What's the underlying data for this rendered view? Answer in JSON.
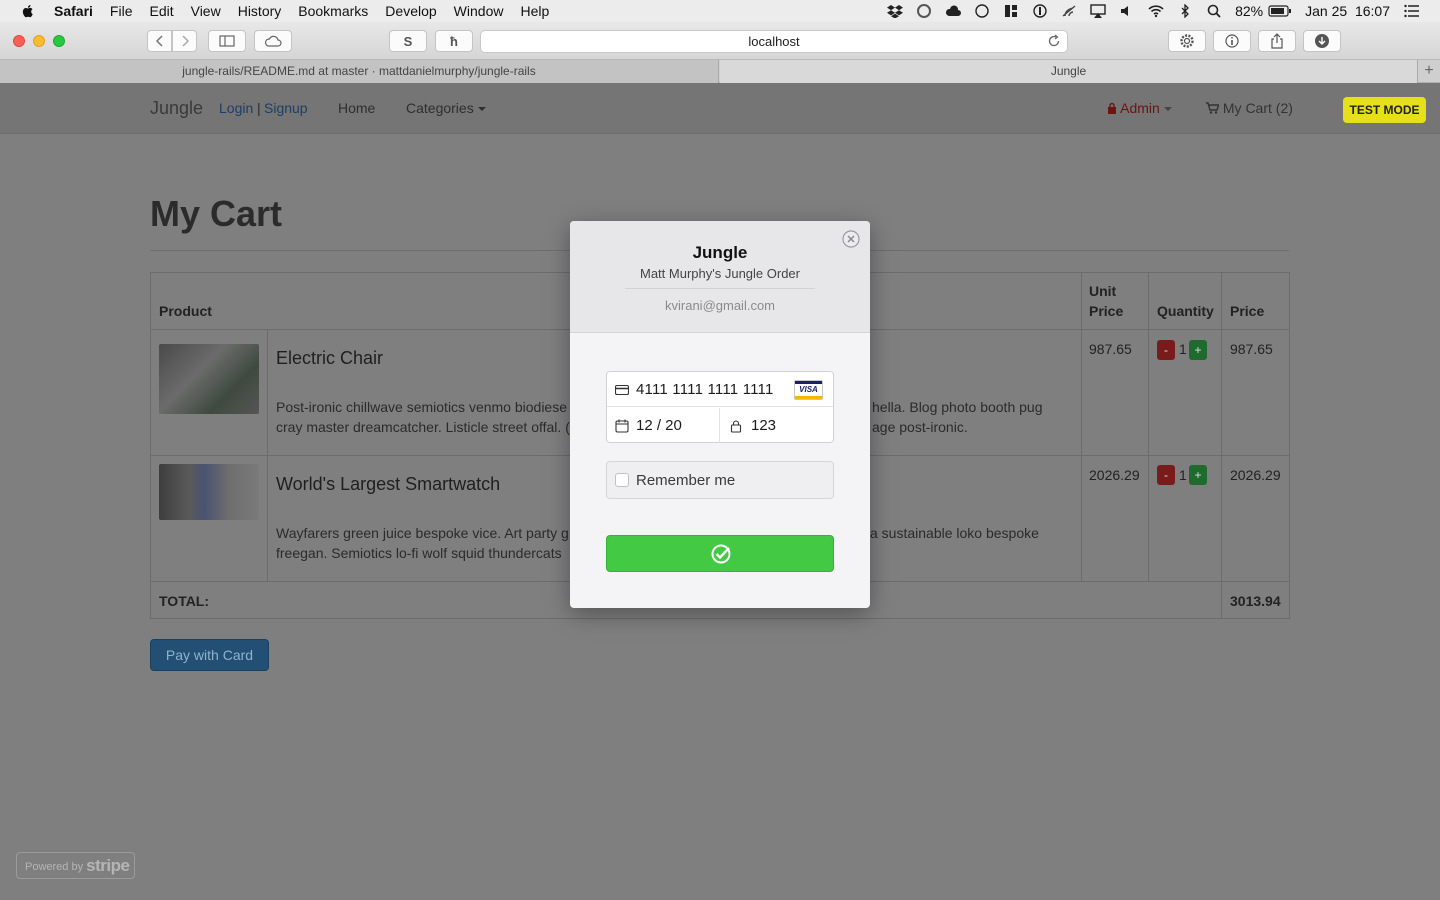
{
  "menubar": {
    "app": "Safari",
    "items": [
      "File",
      "Edit",
      "View",
      "History",
      "Bookmarks",
      "Develop",
      "Window",
      "Help"
    ],
    "battery": "82%",
    "datetime": "Jan 25  16:07"
  },
  "browser": {
    "url": "localhost",
    "tabs": [
      "jungle-rails/README.md at master · mattdanielmurphy/jungle-rails",
      "Jungle"
    ]
  },
  "nav": {
    "brand": "Jungle",
    "login": "Login",
    "separator": "|",
    "signup": "Signup",
    "home": "Home",
    "categories": "Categories",
    "admin": "Admin",
    "cart": "My Cart (2)",
    "test_mode": "TEST MODE"
  },
  "cart": {
    "title": "My Cart",
    "headers": {
      "product": "Product",
      "unit_price_1": "Unit",
      "unit_price_2": "Price",
      "quantity": "Quantity",
      "price": "Price"
    },
    "items": [
      {
        "name": "Electric Chair",
        "desc_left_1": "Post-ironic chillwave semiotics venmo biodiese",
        "desc_right_1": "hella. Blog photo booth pug",
        "desc_left_2": "cray master dreamcatcher. Listicle street offal. (",
        "desc_right_2": "age post-ironic.",
        "unit_price": "987.65",
        "quantity": "1",
        "price": "987.65"
      },
      {
        "name": "World's Largest Smartwatch",
        "desc_left_1": "Wayfarers green juice bespoke vice. Art party g",
        "desc_right_1": "a sustainable loko bespoke",
        "desc_left_2": "freegan. Semiotics lo-fi wolf squid thundercats",
        "desc_right_2": "",
        "unit_price": "2026.29",
        "quantity": "1",
        "price": "2026.29"
      }
    ],
    "total_label": "TOTAL:",
    "total": "3013.94",
    "pay_button": "Pay with Card",
    "minus": "-",
    "plus": "+"
  },
  "stripe": {
    "title": "Jungle",
    "subtitle": "Matt Murphy's Jungle Order",
    "email": "kvirani@gmail.com",
    "card_number": "4111 1111 1111 1111",
    "card_brand": "VISA",
    "expiry": "12 / 20",
    "cvc": "123",
    "remember_me": "Remember me",
    "powered_by": "Powered by",
    "powered_brand": "stripe"
  },
  "colors": {
    "submit_green": "#43c943",
    "test_mode_yellow": "#e5e01a"
  }
}
